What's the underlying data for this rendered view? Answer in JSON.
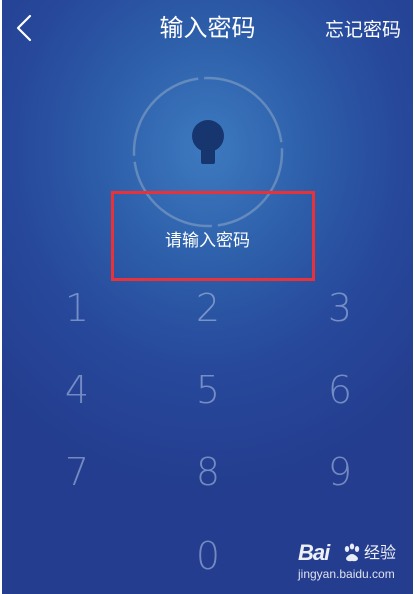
{
  "header": {
    "title": "输入密码",
    "forgot_label": "忘记密码",
    "back_icon": "chevron-left-icon"
  },
  "lock": {
    "icon": "keyhole-icon",
    "hint": "请输入密码"
  },
  "keypad": {
    "keys": [
      "1",
      "2",
      "3",
      "4",
      "5",
      "6",
      "7",
      "8",
      "9",
      "0"
    ]
  },
  "watermark": {
    "logo_text": "Bai",
    "logo_cn": "经验",
    "url": "jingyan.baidu.com"
  },
  "colors": {
    "background": "#2d5ea9",
    "highlight": "#e8323a",
    "key_text": "#b4c8eb"
  }
}
